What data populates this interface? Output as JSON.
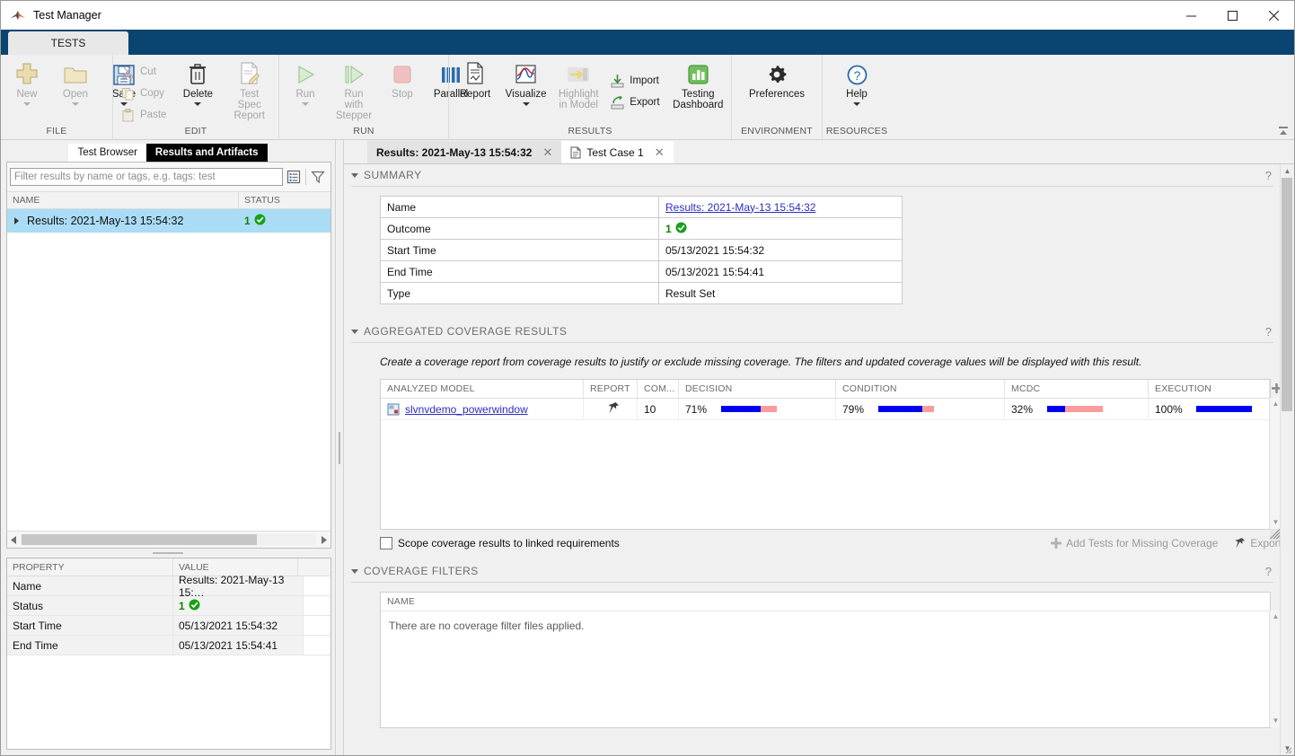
{
  "window": {
    "title": "Test Manager",
    "minimize": "—",
    "maximize": "□",
    "close": "✕"
  },
  "ribbon": {
    "tab_label": "TESTS",
    "groups": [
      {
        "label": "FILE",
        "buttons": [
          {
            "label": "New",
            "icon": "plus-icon",
            "disabled": true,
            "has_caret": true
          },
          {
            "label": "Open",
            "icon": "folder-icon",
            "disabled": true,
            "has_caret": true
          },
          {
            "label": "Save",
            "icon": "save-floppy-icon",
            "disabled": false,
            "has_caret": true
          }
        ]
      },
      {
        "label": "EDIT",
        "small_buttons": [
          {
            "label": "Cut",
            "icon": "scissors-icon",
            "disabled": true
          },
          {
            "label": "Copy",
            "icon": "copy-icon",
            "disabled": true
          },
          {
            "label": "Paste",
            "icon": "clipboard-icon",
            "disabled": true
          }
        ],
        "buttons": [
          {
            "label": "Delete",
            "icon": "trash-icon",
            "disabled": false,
            "has_caret": true
          },
          {
            "label": "Test Spec\nReport",
            "icon": "document-pencil-icon",
            "disabled": true,
            "has_caret": false
          }
        ]
      },
      {
        "label": "RUN",
        "buttons": [
          {
            "label": "Run",
            "icon": "play-triangle-icon",
            "disabled": true,
            "has_caret": true
          },
          {
            "label": "Run with\nStepper",
            "icon": "step-play-icon",
            "disabled": true,
            "has_caret": false
          },
          {
            "label": "Stop",
            "icon": "stop-square-icon",
            "disabled": true,
            "has_caret": false
          },
          {
            "label": "Parallel",
            "icon": "parallel-bars-icon",
            "disabled": false,
            "has_caret": false
          }
        ]
      },
      {
        "label": "RESULTS",
        "buttons": [
          {
            "label": "Report",
            "icon": "report-document-icon",
            "disabled": false,
            "has_caret": false
          },
          {
            "label": "Visualize",
            "icon": "visualize-plot-icon",
            "disabled": false,
            "has_caret": true
          },
          {
            "label": "Highlight\nin Model",
            "icon": "highlight-arrow-icon",
            "disabled": true,
            "has_caret": false
          }
        ],
        "small_buttons": [
          {
            "label": "Import",
            "icon": "import-icon",
            "disabled": false
          },
          {
            "label": "Export",
            "icon": "export-icon",
            "disabled": false
          }
        ],
        "extra_buttons": [
          {
            "label": "Testing\nDashboard",
            "icon": "dashboard-chart-icon",
            "disabled": false
          }
        ]
      },
      {
        "label": "ENVIRONMENT",
        "buttons": [
          {
            "label": "Preferences",
            "icon": "gear-icon",
            "disabled": false,
            "has_caret": false
          }
        ]
      },
      {
        "label": "RESOURCES",
        "buttons": [
          {
            "label": "Help",
            "icon": "help-question-icon",
            "disabled": false,
            "has_caret": true
          }
        ]
      }
    ]
  },
  "left_panel": {
    "tabs": [
      {
        "label": "Test Browser",
        "active": false
      },
      {
        "label": "Results and Artifacts",
        "active": true
      }
    ],
    "filter_placeholder": "Filter results by name or tags, e.g. tags: test",
    "filter_value": "",
    "tree_headers": [
      "NAME",
      "STATUS"
    ],
    "tree_rows": [
      {
        "name": "Results: 2021-May-13 15:54:32",
        "status_count": "1",
        "status_icon": "pass-check-icon",
        "selected": true
      }
    ],
    "properties_headers": [
      "PROPERTY",
      "VALUE"
    ],
    "properties": [
      {
        "key": "Name",
        "value": "Results: 2021-May-13 15:…"
      },
      {
        "key": "Status",
        "value": "1",
        "icon": "pass-check-icon"
      },
      {
        "key": "Start Time",
        "value": "05/13/2021 15:54:32"
      },
      {
        "key": "End Time",
        "value": "05/13/2021 15:54:41"
      }
    ]
  },
  "right_panel": {
    "tabs": [
      {
        "label": "Results: 2021-May-13 15:54:32",
        "active": true,
        "has_icon": false
      },
      {
        "label": "Test Case 1",
        "active": false,
        "has_icon": true
      }
    ],
    "summary": {
      "title": "SUMMARY",
      "help": "?",
      "rows": [
        {
          "key": "Name",
          "value": "Results: 2021-May-13 15:54:32",
          "is_link": true
        },
        {
          "key": "Outcome",
          "value": "1",
          "icon": "pass-check-icon"
        },
        {
          "key": "Start Time",
          "value": "05/13/2021 15:54:32"
        },
        {
          "key": "End Time",
          "value": "05/13/2021 15:54:41"
        },
        {
          "key": "Type",
          "value": "Result Set"
        }
      ]
    },
    "coverage": {
      "title": "AGGREGATED COVERAGE RESULTS",
      "help": "?",
      "note": "Create a coverage report from coverage results to justify or exclude missing coverage. The filters and updated coverage values will be displayed with this result.",
      "headers": [
        "ANALYZED MODEL",
        "REPORT",
        "COM...",
        "DECISION",
        "CONDITION",
        "MCDC",
        "EXECUTION"
      ],
      "rows": [
        {
          "model": "slvnvdemo_powerwindow",
          "model_icon": "model-file-icon",
          "report_icon": "report-pin-icon",
          "com": "10",
          "decision": "71%",
          "decision_pct": 71,
          "condition": "79%",
          "condition_pct": 79,
          "mcdc": "32%",
          "mcdc_pct": 32,
          "execution": "100%",
          "execution_pct": 100
        }
      ],
      "add_column_icon": "plus-icon",
      "scope_checkbox_label": "Scope coverage results to linked requirements",
      "scope_checked": false,
      "actions": [
        {
          "label": "Add Tests for Missing Coverage",
          "icon": "plus-icon"
        },
        {
          "label": "Export",
          "icon": "export-pin-icon"
        }
      ]
    },
    "coverage_filters": {
      "title": "COVERAGE FILTERS",
      "help": "?",
      "header": "NAME",
      "empty_message": "There are no coverage filter files applied."
    }
  },
  "colors": {
    "ribbon_tab_bg": "#0a4571",
    "selection": "#aadcf5",
    "pass_green": "#128000",
    "link": "#2d2dc0",
    "bar_covered": "#0000f0",
    "bar_uncovered": "#fb9c9c"
  }
}
